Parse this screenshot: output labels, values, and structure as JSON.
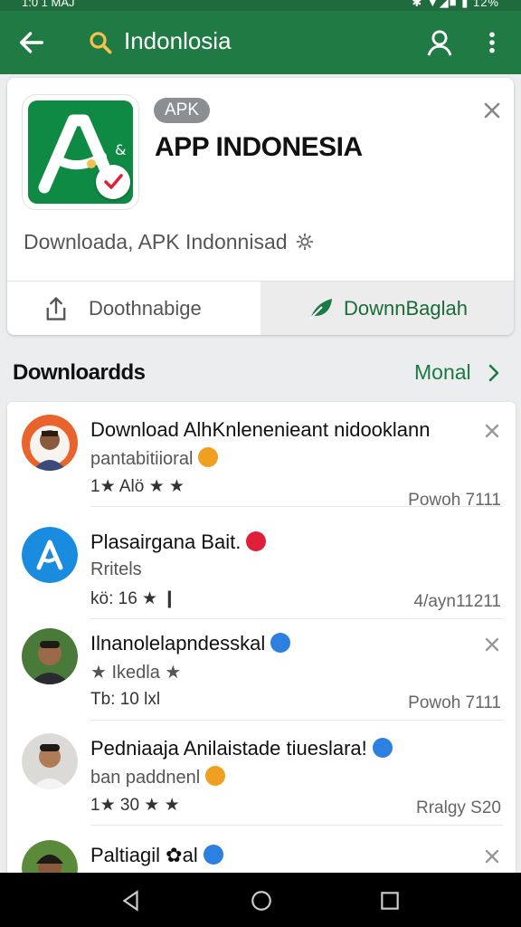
{
  "status": {
    "time": "1:0 1 MAJ",
    "right": "✱ ▼◢■ ▮ 12%"
  },
  "appbar": {
    "query": "Indonlosia"
  },
  "card": {
    "badge": "APK",
    "title": "APP INDONESIA",
    "subtitle": "Downloada, APK Indonnisad",
    "left_button": "Doothnabige",
    "right_button": "DownnBaglah"
  },
  "section": {
    "title": "Downloardds",
    "link": "Monal"
  },
  "items": [
    {
      "name": "Download AlhKnlenenieant nidooklann",
      "line2": "pantabitiioral",
      "line3": "1★ Alö ★ ★",
      "meta": "Powoh 7111",
      "badge_color": "#f0a020"
    },
    {
      "name": "Plasairgana Bait.",
      "line2": "Rritels",
      "line3": "kö:  16 ★ ❙",
      "meta": "4/ayn11211",
      "badge_color": "#e0203a"
    },
    {
      "name": "Ilnanolelapndesskal",
      "line2": "★ Ikedla ★",
      "line3": "Tb:  10 lxl",
      "meta": "Powoh 7111",
      "badge_color": "#2d7fe0"
    },
    {
      "name": "Pedniaaja Anilaistade tiueslara!",
      "line2": "ban paddnenl",
      "line3": "1★ 30 ★ ★",
      "meta": "Rralgy S20",
      "badge_color": "#2d7fe0"
    },
    {
      "name": "Paltiagil ✿al",
      "line2": "",
      "line3": "",
      "meta": "",
      "badge_color": "#2d7fe0"
    }
  ],
  "colors": {
    "appbar": "#1f7a44",
    "accent": "#1b7a45",
    "star": "#f2a11a"
  }
}
